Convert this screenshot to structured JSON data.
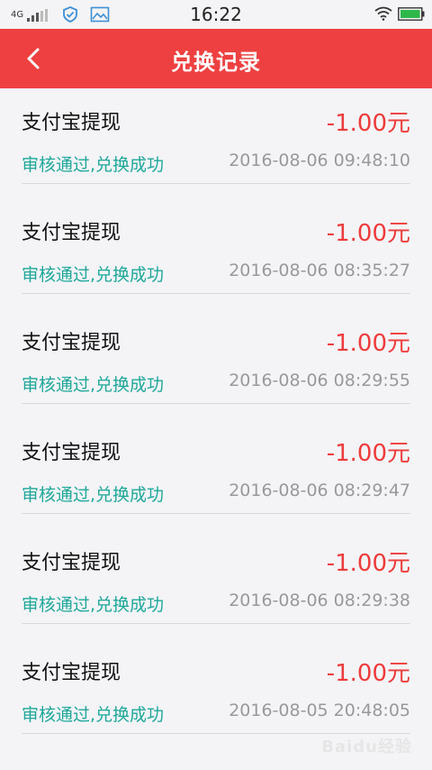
{
  "status_bar": {
    "network": "4G",
    "time": "16:22"
  },
  "header": {
    "title": "兑换记录"
  },
  "records": [
    {
      "name": "支付宝提现",
      "amount": "-1.00元",
      "status": "审核通过,兑换成功",
      "time": "2016-08-06 09:48:10"
    },
    {
      "name": "支付宝提现",
      "amount": "-1.00元",
      "status": "审核通过,兑换成功",
      "time": "2016-08-06 08:35:27"
    },
    {
      "name": "支付宝提现",
      "amount": "-1.00元",
      "status": "审核通过,兑换成功",
      "time": "2016-08-06 08:29:55"
    },
    {
      "name": "支付宝提现",
      "amount": "-1.00元",
      "status": "审核通过,兑换成功",
      "time": "2016-08-06 08:29:47"
    },
    {
      "name": "支付宝提现",
      "amount": "-1.00元",
      "status": "审核通过,兑换成功",
      "time": "2016-08-06 08:29:38"
    },
    {
      "name": "支付宝提现",
      "amount": "-1.00元",
      "status": "审核通过,兑换成功",
      "time": "2016-08-05 20:48:05"
    }
  ],
  "watermark": "Baidu经验",
  "colors": {
    "header": "#ee4040",
    "amount": "#ee3b3b",
    "status": "#1fa79a"
  }
}
